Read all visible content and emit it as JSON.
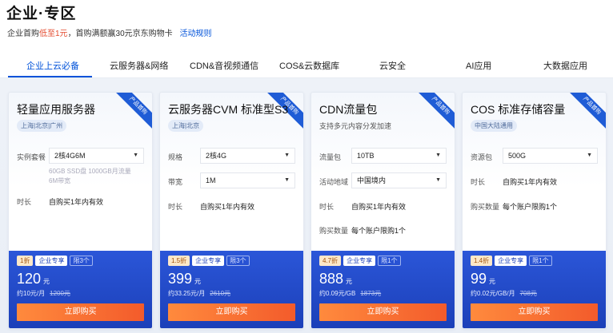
{
  "header": {
    "title": "企业·专区",
    "sub_prefix": "企业首购",
    "sub_highlight": "低至1元",
    "sub_suffix": "，首购满额赢30元京东购物卡",
    "rule_link": "活动规则"
  },
  "tabs": [
    "企业上云必备",
    "云服务器&网络",
    "CDN&音视频通信",
    "COS&云数据库",
    "云安全",
    "AI应用",
    "大数据应用"
  ],
  "active_tab": "企业上云必备",
  "colors": {
    "accent": "#0052d9",
    "footer_blue": "#1b3fb8",
    "buy_orange": "#f35b2b"
  },
  "cards": [
    {
      "ribbon": "产品首购",
      "title": "轻量应用服务器",
      "region": "上海|北京|广州",
      "field1_label": "实例套餐",
      "field1_value": "2核4G6M",
      "note": "60GB SSD盘 1000GB月流量 6M带宽",
      "field2_label": "时长",
      "field2_value": "自购买1年内有效",
      "discount": "1折",
      "corp": "企业专享",
      "limit": "限3个",
      "price": "120",
      "unit": "元",
      "per": "约10元/月",
      "orig": "1200元",
      "buy": "立即购买"
    },
    {
      "ribbon": "产品首购",
      "title": "云服务器CVM 标准型S3",
      "region": "上海|北京",
      "field1_label": "规格",
      "field1_value": "2核4G",
      "field2_label": "带宽",
      "field2_value": "1M",
      "field3_label": "时长",
      "field3_value": "自购买1年内有效",
      "discount": "1.5折",
      "corp": "企业专享",
      "limit": "限3个",
      "price": "399",
      "unit": "元",
      "per": "约33.25元/月",
      "orig": "2610元",
      "buy": "立即购买"
    },
    {
      "ribbon": "产品首购",
      "title": "CDN流量包",
      "desc": "支持多元内容分发加速",
      "field1_label": "流量包",
      "field1_value": "10TB",
      "field2_label": "活动地域",
      "field2_value": "中国境内",
      "field3_label": "时长",
      "field3_value": "自购买1年内有效",
      "field4_label": "购买数量",
      "field4_value": "每个账户限购1个",
      "discount": "4.7折",
      "corp": "企业专享",
      "limit": "限1个",
      "price": "888",
      "unit": "元",
      "per": "约0.09元/GB",
      "orig": "1873元",
      "buy": "立即购买"
    },
    {
      "ribbon": "产品首购",
      "title": "COS 标准存储容量",
      "region": "中国大陆通用",
      "field1_label": "资源包",
      "field1_value": "500G",
      "field2_label": "时长",
      "field2_value": "自购买1年内有效",
      "field3_label": "购买数量",
      "field3_value": "每个账户限购1个",
      "discount": "1.4折",
      "corp": "企业专享",
      "limit": "限1个",
      "price": "99",
      "unit": "元",
      "per": "约0.02元/GB/月",
      "orig": "708元",
      "buy": "立即购买"
    }
  ]
}
